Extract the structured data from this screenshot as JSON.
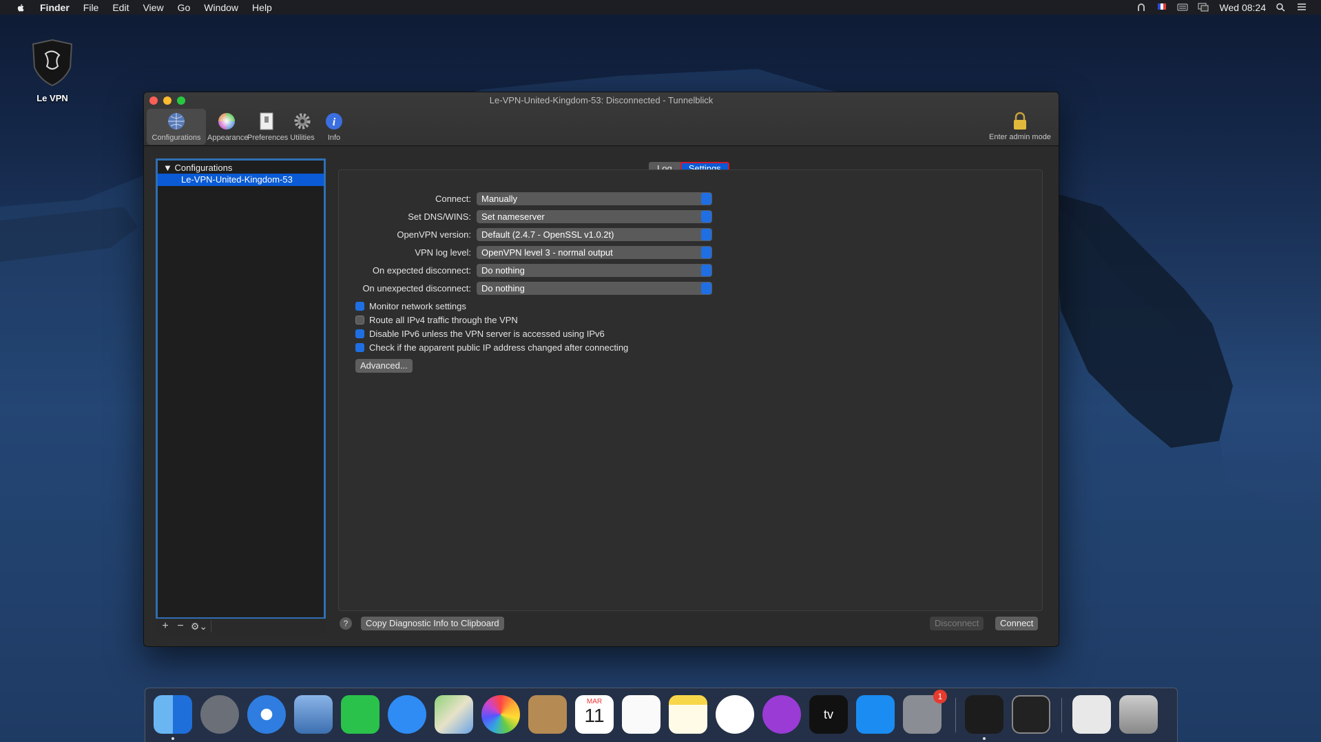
{
  "menubar": {
    "app": "Finder",
    "items": [
      "File",
      "Edit",
      "View",
      "Go",
      "Window",
      "Help"
    ],
    "clock": "Wed 08:24"
  },
  "desktop": {
    "icon_label": "Le VPN"
  },
  "window": {
    "title": "Le-VPN-United-Kingdom-53: Disconnected - Tunnelblick",
    "toolbar": [
      {
        "label": "Configurations",
        "icon": "globe-icon"
      },
      {
        "label": "Appearance",
        "icon": "color-wheel-icon"
      },
      {
        "label": "Preferences",
        "icon": "switch-icon"
      },
      {
        "label": "Utilities",
        "icon": "gear-icon"
      },
      {
        "label": "Info",
        "icon": "info-icon"
      }
    ],
    "admin_label": "Enter admin mode"
  },
  "sidebar": {
    "header": "Configurations",
    "items": [
      "Le-VPN-United-Kingdom-53"
    ],
    "add": "+",
    "remove": "−",
    "gear": "⚙⌄"
  },
  "tabs": {
    "log": "Log",
    "settings": "Settings"
  },
  "settings": [
    {
      "label": "Connect:",
      "value": "Manually"
    },
    {
      "label": "Set DNS/WINS:",
      "value": "Set nameserver"
    },
    {
      "label": "OpenVPN version:",
      "value": "Default (2.4.7 - OpenSSL v1.0.2t)"
    },
    {
      "label": "VPN log level:",
      "value": "OpenVPN level 3 - normal output"
    },
    {
      "label": "On expected disconnect:",
      "value": "Do nothing"
    },
    {
      "label": "On unexpected disconnect:",
      "value": "Do nothing"
    }
  ],
  "checkboxes": [
    {
      "label": "Monitor network settings",
      "checked": true
    },
    {
      "label": "Route all IPv4 traffic through the VPN",
      "checked": false
    },
    {
      "label": "Disable IPv6 unless the VPN server is accessed using IPv6",
      "checked": true
    },
    {
      "label": "Check if the apparent public IP address changed after connecting",
      "checked": true
    }
  ],
  "buttons": {
    "advanced": "Advanced...",
    "help": "?",
    "copy_diag": "Copy Diagnostic Info to Clipboard",
    "disconnect": "Disconnect",
    "connect": "Connect"
  },
  "dock": {
    "calendar_month": "MAR",
    "calendar_day": "11",
    "prefs_badge": "1",
    "tv_label": "tv"
  },
  "colors": {
    "accent": "#0a5bd5",
    "highlight_border": "#d0192e"
  }
}
